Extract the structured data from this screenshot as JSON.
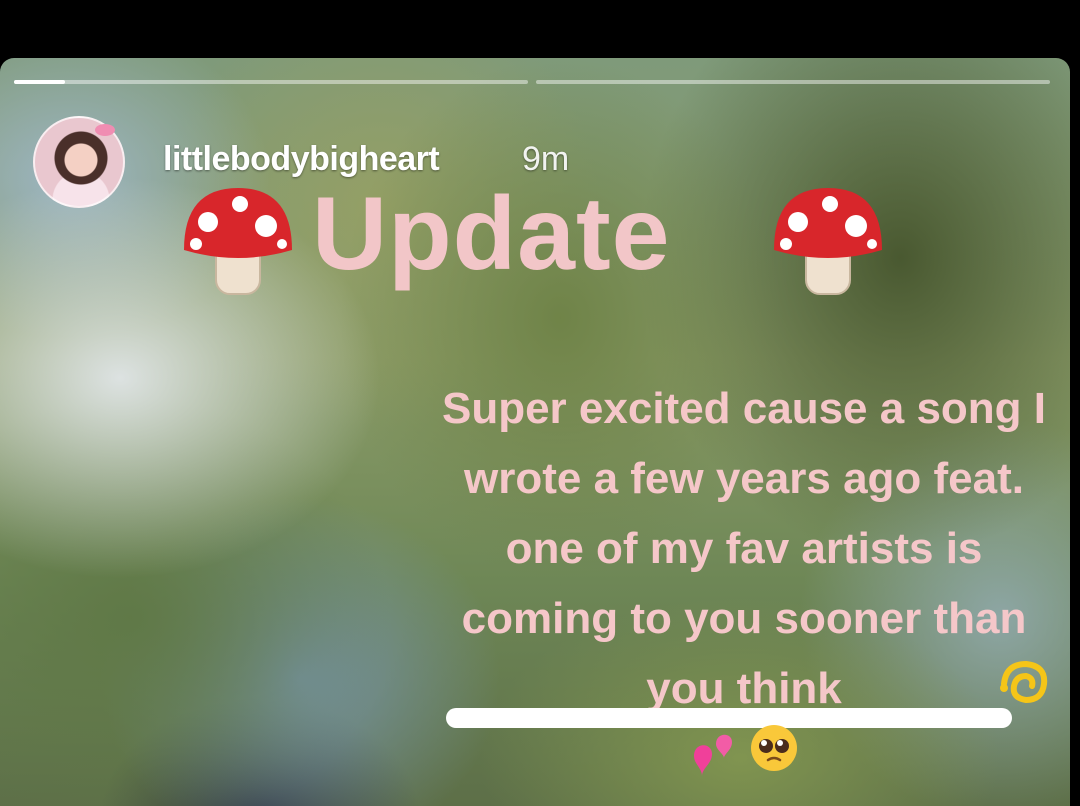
{
  "story": {
    "username": "littlebodybigheart",
    "time_ago": "9m",
    "title": "Update",
    "body": "Super excited cause a song I wrote a few years ago feat. one of my fav artists is coming to you sooner than you think",
    "progress": [
      0.1,
      0.0
    ]
  },
  "icons": {
    "mushroom_left": "mushroom-emoji",
    "mushroom_right": "mushroom-emoji",
    "sparkle": "dizzy-emoji",
    "hearts": "two-hearts-emoji",
    "pleading": "pleading-face-emoji"
  },
  "colors": {
    "title_text": "#f2c6c8",
    "body_text": "#f5c7c9"
  }
}
